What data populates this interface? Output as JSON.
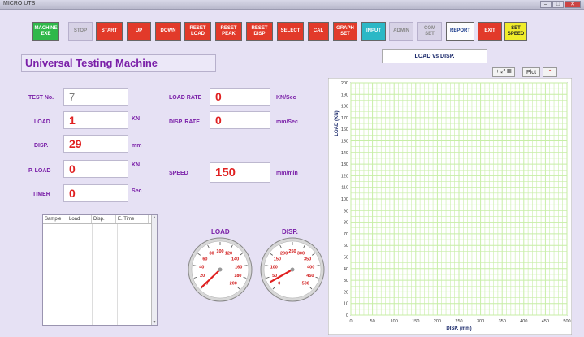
{
  "window": {
    "title": "MICRO UTS"
  },
  "toolbar": [
    {
      "label": "MACHINE\nEXE",
      "style": "green"
    },
    {
      "label": "STOP",
      "style": "dim"
    },
    {
      "label": "START",
      "style": "red"
    },
    {
      "label": "UP",
      "style": "red"
    },
    {
      "label": "DOWN",
      "style": "red"
    },
    {
      "label": "RESET\nLOAD",
      "style": "red"
    },
    {
      "label": "RESET\nPEAK",
      "style": "red"
    },
    {
      "label": "RESET\nDISP",
      "style": "red"
    },
    {
      "label": "SELECT",
      "style": "red"
    },
    {
      "label": "CAL",
      "style": "red"
    },
    {
      "label": "GRAPH\nSET",
      "style": "red"
    },
    {
      "label": "INPUT",
      "style": "teal"
    },
    {
      "label": "ADMIN",
      "style": "dim"
    },
    {
      "label": "COM\nSET",
      "style": "dim"
    },
    {
      "label": "REPORT",
      "style": "white"
    },
    {
      "label": "EXIT",
      "style": "red"
    },
    {
      "label": "SET\nSPEED",
      "style": "yellow"
    }
  ],
  "app_title": "Universal Testing Machine",
  "fields": {
    "test_no": {
      "label": "TEST No.",
      "value": "7"
    },
    "load": {
      "label": "LOAD",
      "value": "1",
      "unit": "KN"
    },
    "disp": {
      "label": "DISP.",
      "value": "29",
      "unit": "mm"
    },
    "peak_load": {
      "label": "P. LOAD",
      "value": "0",
      "unit": "KN"
    },
    "timer": {
      "label": "TIMER",
      "value": "0",
      "unit": "Sec"
    },
    "load_rate": {
      "label": "LOAD RATE",
      "value": "0",
      "unit": "KN/Sec"
    },
    "disp_rate": {
      "label": "DISP. RATE",
      "value": "0",
      "unit": "mm/Sec"
    },
    "speed": {
      "label": "SPEED",
      "value": "150",
      "unit": "mm/min"
    }
  },
  "table": {
    "columns": [
      "Sample",
      "Load",
      "Disp.",
      "E. Time"
    ],
    "rows": []
  },
  "gauges": {
    "load": {
      "title": "LOAD",
      "ticks": [
        "0",
        "20",
        "40",
        "60",
        "80",
        "100",
        "120",
        "140",
        "160",
        "180",
        "200"
      ],
      "min": 0,
      "max": 200,
      "value": 1
    },
    "disp": {
      "title": "DISP.",
      "ticks": [
        "0",
        "50",
        "100",
        "150",
        "200",
        "250",
        "300",
        "350",
        "400",
        "450",
        "500"
      ],
      "min": 0,
      "max": 500,
      "value": 29
    }
  },
  "chart": {
    "title": "LOAD  vs  DISP.",
    "tools": {
      "zoom": "+ ⤢ ▦",
      "plot": "Plot"
    },
    "ylabel": "LOAD  (KN)",
    "xlabel": "DISP.  (mm)",
    "yticks": [
      "0",
      "10",
      "20",
      "30",
      "40",
      "50",
      "60",
      "70",
      "80",
      "90",
      "100",
      "110",
      "120",
      "130",
      "140",
      "150",
      "160",
      "170",
      "180",
      "190",
      "200"
    ],
    "xticks": [
      "0",
      "50",
      "100",
      "150",
      "200",
      "250",
      "300",
      "350",
      "400",
      "450",
      "500"
    ]
  },
  "colors": {
    "accent": "#7a1fa8",
    "value_red": "#e02020",
    "grid_green": "#b6e68a",
    "bg": "#e6e1f4",
    "button_red": "#e23a2a",
    "button_green": "#2fb84a"
  }
}
